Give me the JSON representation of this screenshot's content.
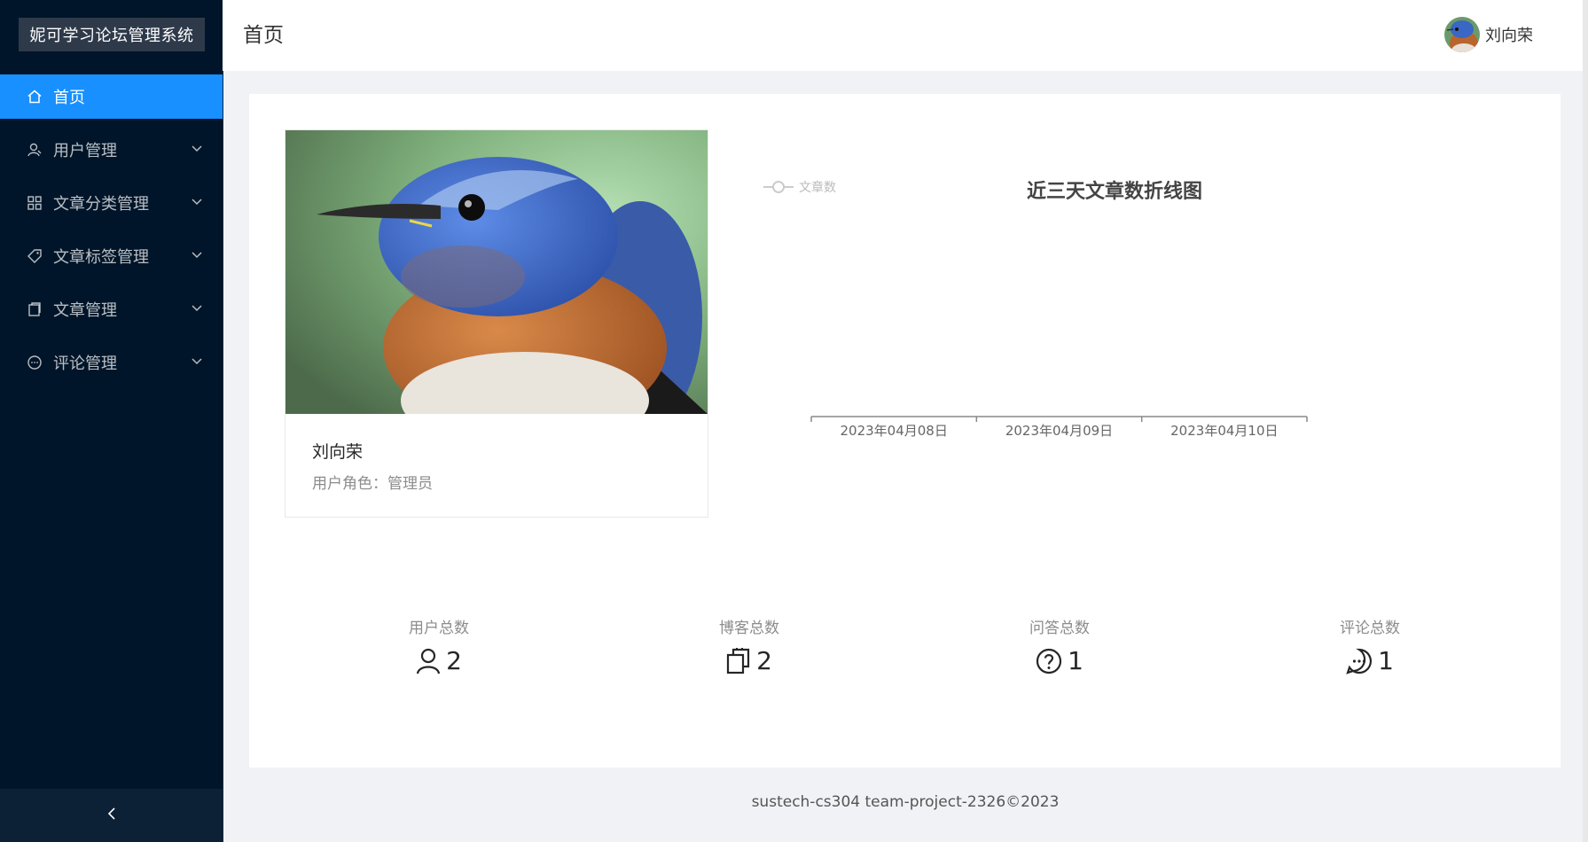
{
  "app": {
    "title": "妮可学习论坛管理系统"
  },
  "sidebar": {
    "items": [
      {
        "label": "首页",
        "icon": "home-icon",
        "active": true
      },
      {
        "label": "用户管理",
        "icon": "user-icon",
        "active": false
      },
      {
        "label": "文章分类管理",
        "icon": "grid-icon",
        "active": false
      },
      {
        "label": "文章标签管理",
        "icon": "tag-icon",
        "active": false
      },
      {
        "label": "文章管理",
        "icon": "document-icon",
        "active": false
      },
      {
        "label": "评论管理",
        "icon": "comment-icon",
        "active": false
      }
    ],
    "collapse_icon": "chevron-left-icon"
  },
  "header": {
    "page_title": "首页",
    "user_name": "刘向荣"
  },
  "profile": {
    "name": "刘向荣",
    "role_label": "用户角色：",
    "role_value": "管理员"
  },
  "chart_data": {
    "type": "line",
    "title": "近三天文章数折线图",
    "categories": [
      "2023年04月08日",
      "2023年04月09日",
      "2023年04月10日"
    ],
    "series": [
      {
        "name": "文章数",
        "values": []
      }
    ],
    "legend_position": "top-left"
  },
  "stats": [
    {
      "label": "用户总数",
      "value": "2",
      "icon": "user-icon"
    },
    {
      "label": "博客总数",
      "value": "2",
      "icon": "document-icon"
    },
    {
      "label": "问答总数",
      "value": "1",
      "icon": "question-circle-icon"
    },
    {
      "label": "评论总数",
      "value": "1",
      "icon": "comment-icon"
    }
  ],
  "footer": {
    "text": "sustech-cs304 team-project-2326©2023"
  },
  "colors": {
    "sidebar_bg": "#001529",
    "active_bg": "#1890ff",
    "page_bg": "#f0f2f5"
  }
}
